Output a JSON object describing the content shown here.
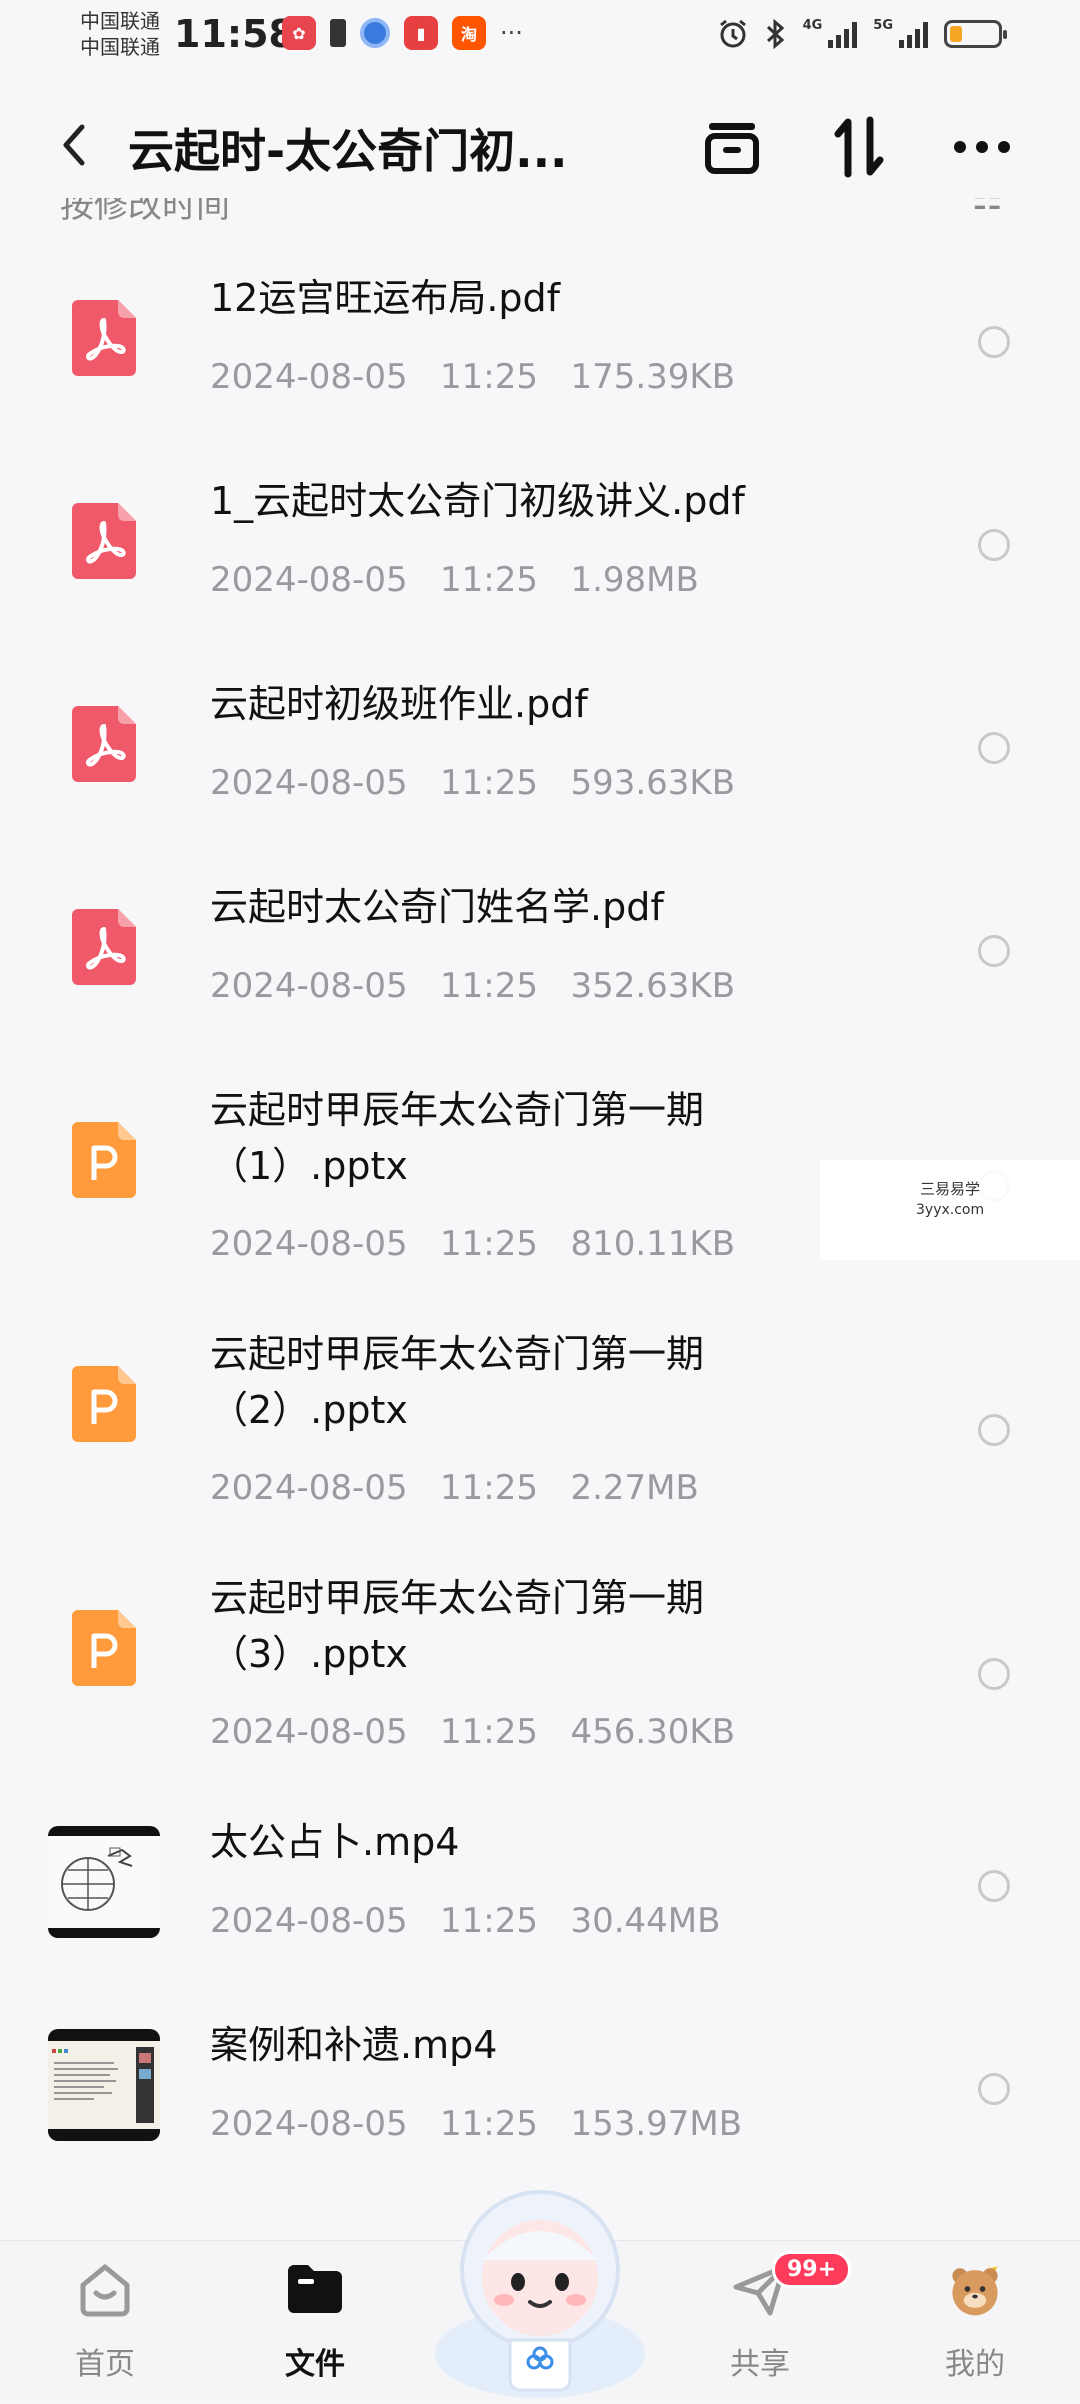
{
  "status_bar": {
    "carrier_1": "中国联通",
    "carrier_2": "中国联通",
    "time": "11:58",
    "network_1": "4G",
    "network_2": "5G",
    "battery_level": 0.25,
    "app_icons": [
      "photo-app-icon",
      "sim-icon",
      "browser-icon",
      "reader-app-icon",
      "taobao-icon"
    ],
    "taobao_label": "淘",
    "more": "···",
    "right_icons": [
      "alarm-icon",
      "bluetooth-icon",
      "signal-icon",
      "battery-icon"
    ]
  },
  "header": {
    "title": "云起时-太公奇门初...",
    "icons": [
      "back-icon",
      "archive-icon",
      "sort-icon",
      "more-icon"
    ]
  },
  "section_peek": {
    "left": "按修改时间",
    "right": "☷"
  },
  "files": [
    {
      "name": "12运宫旺运布局.pdf",
      "date": "2024-08-05",
      "time": "11:25",
      "size": "175.39KB",
      "type": "pdf"
    },
    {
      "name": "1_云起时太公奇门初级讲义.pdf",
      "date": "2024-08-05",
      "time": "11:25",
      "size": "1.98MB",
      "type": "pdf"
    },
    {
      "name": "云起时初级班作业.pdf",
      "date": "2024-08-05",
      "time": "11:25",
      "size": "593.63KB",
      "type": "pdf"
    },
    {
      "name": "云起时太公奇门姓名学.pdf",
      "date": "2024-08-05",
      "time": "11:25",
      "size": "352.63KB",
      "type": "pdf"
    },
    {
      "name": "云起时甲辰年太公奇门第一期\n（1）.pptx",
      "date": "2024-08-05",
      "time": "11:25",
      "size": "810.11KB",
      "type": "pptx"
    },
    {
      "name": "云起时甲辰年太公奇门第一期\n（2）.pptx",
      "date": "2024-08-05",
      "time": "11:25",
      "size": "2.27MB",
      "type": "pptx"
    },
    {
      "name": "云起时甲辰年太公奇门第一期\n（3）.pptx",
      "date": "2024-08-05",
      "time": "11:25",
      "size": "456.30KB",
      "type": "pptx"
    },
    {
      "name": "太公占卜.mp4",
      "date": "2024-08-05",
      "time": "11:25",
      "size": "30.44MB",
      "type": "mp4-whiteboard"
    },
    {
      "name": "案例和补遗.mp4",
      "date": "2024-08-05",
      "time": "11:25",
      "size": "153.97MB",
      "type": "mp4-screen"
    }
  ],
  "watermark": {
    "line1": "三易易学",
    "line2": "3yyx.com"
  },
  "bottom_nav": {
    "items": [
      {
        "label": "首页",
        "icon": "home-icon",
        "active": false
      },
      {
        "label": "文件",
        "icon": "folder-icon",
        "active": true
      },
      {
        "label": "共享",
        "icon": "share-icon",
        "active": false,
        "badge": "99+"
      },
      {
        "label": "我的",
        "icon": "profile-icon",
        "active": false
      }
    ],
    "center_icon": "mascot-assistant-icon"
  },
  "colors": {
    "pdf": "#f0596a",
    "pptx": "#ff9a3d",
    "badge": "#ff3b5c",
    "meta_text": "#9a9a9e"
  }
}
